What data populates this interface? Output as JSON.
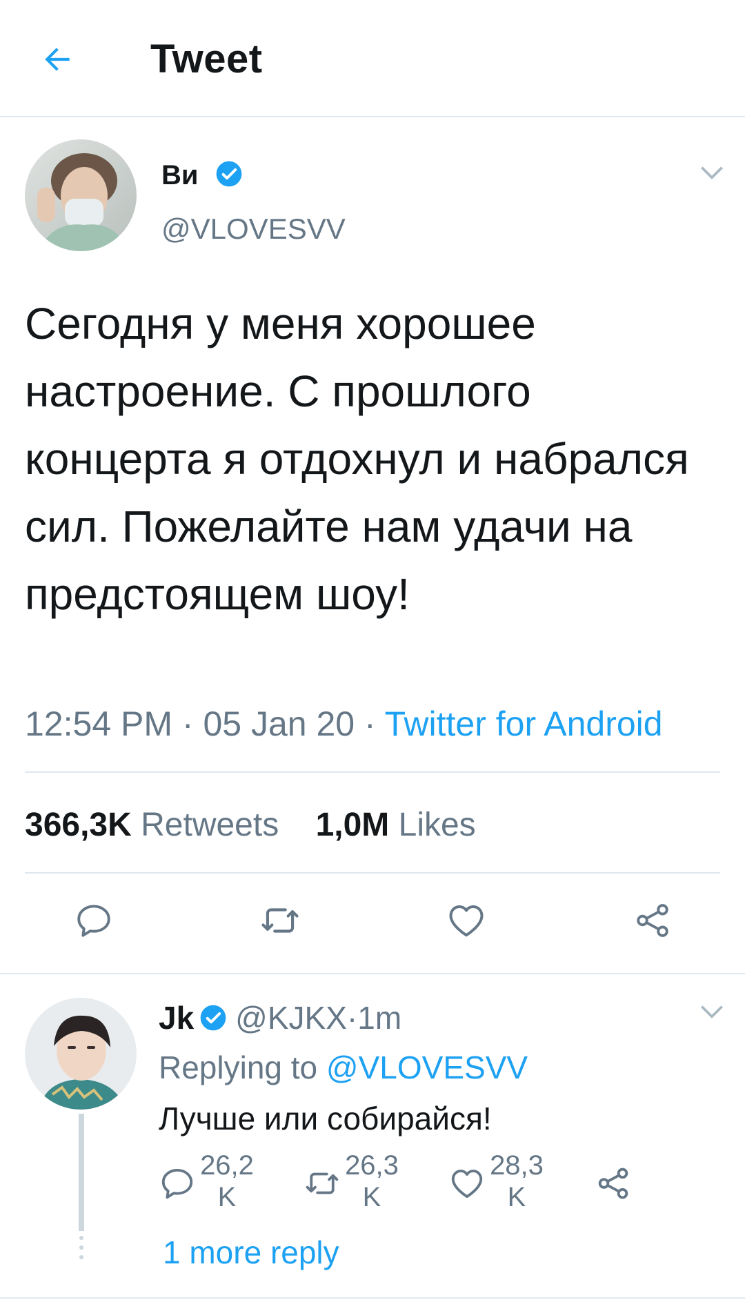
{
  "header": {
    "title": "Tweet",
    "back_icon": "arrow-left-icon"
  },
  "colors": {
    "accent": "#1da1f2",
    "text": "#14171a",
    "secondary": "#657786",
    "divider": "#e1e8ed"
  },
  "tweet": {
    "name": "Ви",
    "handle": "@VLOVESVV",
    "text": "Сегодня у меня хорошее настроение. С прошлого концерта я отдохнул и набрался сил. Пожелайте нам удачи на предстоящем шоу!",
    "time": "12:54 PM",
    "date": "05 Jan 20",
    "source": "Twitter for Android",
    "sep": " · ",
    "retweets_count": "366,3K",
    "retweets_label": "Retweets",
    "likes_count": "1,0M",
    "likes_label": "Likes"
  },
  "reply": {
    "name": "Jk",
    "handle": "@KJKX",
    "sep": " · ",
    "time": "1m",
    "replying_prefix": "Replying to ",
    "replying_handle": "@VLOVESVV",
    "text": "Лучше или собирайся!",
    "reply_count_line1": "26,2",
    "reply_count_line2": "K",
    "retweet_count_line1": "26,3",
    "retweet_count_line2": "K",
    "like_count_line1": "28,3",
    "like_count_line2": "K",
    "more_replies": "1 more reply"
  }
}
